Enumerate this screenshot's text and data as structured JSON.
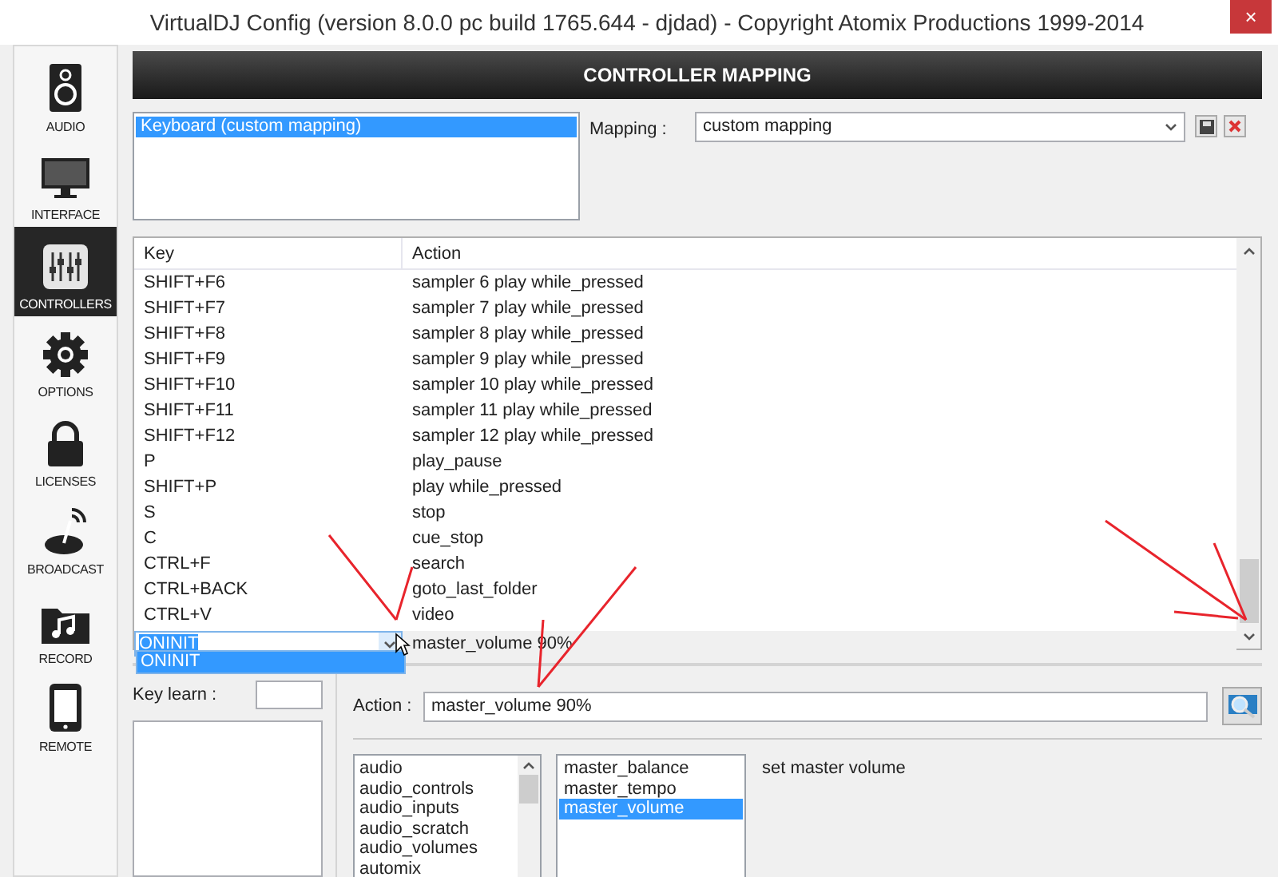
{
  "window": {
    "title": "VirtualDJ Config (version 8.0.0 pc build 1765.644 - djdad) - Copyright Atomix Productions 1999-2014",
    "close": "×"
  },
  "sidebar": {
    "items": [
      {
        "kind": "audio",
        "label": "AUDIO",
        "selected": false
      },
      {
        "kind": "interface",
        "label": "INTERFACE",
        "selected": false
      },
      {
        "kind": "controllers",
        "label": "CONTROLLERS",
        "selected": true
      },
      {
        "kind": "options",
        "label": "OPTIONS",
        "selected": false
      },
      {
        "kind": "licenses",
        "label": "LICENSES",
        "selected": false
      },
      {
        "kind": "broadcast",
        "label": "BROADCAST",
        "selected": false
      },
      {
        "kind": "record",
        "label": "RECORD",
        "selected": false
      },
      {
        "kind": "remote",
        "label": "REMOTE",
        "selected": false
      }
    ]
  },
  "header": "CONTROLLER MAPPING",
  "devices": [
    {
      "label": "Keyboard (custom mapping)",
      "selected": true
    }
  ],
  "mapping": {
    "label": "Mapping :",
    "value": "custom mapping"
  },
  "table": {
    "columns": [
      "Key",
      "Action"
    ],
    "rows": [
      {
        "key": "SHIFT+F6",
        "action": "sampler 6 play while_pressed"
      },
      {
        "key": "SHIFT+F7",
        "action": "sampler 7 play while_pressed"
      },
      {
        "key": "SHIFT+F8",
        "action": "sampler 8 play while_pressed"
      },
      {
        "key": "SHIFT+F9",
        "action": "sampler 9 play while_pressed"
      },
      {
        "key": "SHIFT+F10",
        "action": "sampler 10 play while_pressed"
      },
      {
        "key": "SHIFT+F11",
        "action": "sampler 11 play while_pressed"
      },
      {
        "key": "SHIFT+F12",
        "action": "sampler 12 play while_pressed"
      },
      {
        "key": "P",
        "action": "play_pause"
      },
      {
        "key": "SHIFT+P",
        "action": "play while_pressed"
      },
      {
        "key": "S",
        "action": "stop"
      },
      {
        "key": "C",
        "action": "cue_stop"
      },
      {
        "key": "CTRL+F",
        "action": "search"
      },
      {
        "key": "CTRL+BACK",
        "action": "goto_last_folder"
      },
      {
        "key": "CTRL+V",
        "action": "video"
      }
    ],
    "editing_row": {
      "key": "ONINIT",
      "action": "master_volume 90%",
      "options": [
        {
          "label": "ONINIT",
          "selected": true
        }
      ]
    }
  },
  "key_learn": {
    "label": "Key learn :"
  },
  "action": {
    "label": "Action :",
    "value": "master_volume 90%"
  },
  "categories": [
    {
      "label": "audio",
      "selected": false
    },
    {
      "label": "audio_controls",
      "selected": false
    },
    {
      "label": "audio_inputs",
      "selected": false
    },
    {
      "label": "audio_scratch",
      "selected": false
    },
    {
      "label": "audio_volumes",
      "selected": false
    },
    {
      "label": "automix",
      "selected": false
    }
  ],
  "verbs": [
    {
      "label": "master_balance",
      "selected": false
    },
    {
      "label": "master_tempo",
      "selected": false
    },
    {
      "label": "master_volume",
      "selected": true
    }
  ],
  "description": "set master volume"
}
